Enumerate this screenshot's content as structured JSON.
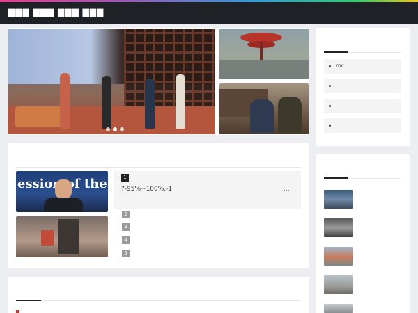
{
  "header": {
    "site_title": "▇▇▇ ▇▇▇ ▇▇▇ ▇▇▇"
  },
  "hero": {
    "slides": 3,
    "active_slide": 1
  },
  "news": {
    "ranking": [
      {
        "rank": "1",
        "text": "?-95%~100%,-1"
      },
      {
        "rank": "2",
        "text": ""
      },
      {
        "rank": "3",
        "text": ""
      },
      {
        "rank": "4",
        "text": ""
      },
      {
        "rank": "5",
        "text": ""
      }
    ],
    "more_label": "..."
  },
  "sidebar": {
    "list_items": [
      {
        "label": "mc"
      },
      {
        "label": ""
      },
      {
        "label": ""
      },
      {
        "label": ""
      }
    ]
  },
  "colors": {
    "topbar": "#1e2125",
    "background": "#eceef1",
    "card": "#ffffff",
    "rank_first": "#222222",
    "rank_other": "#9a9a9a"
  }
}
